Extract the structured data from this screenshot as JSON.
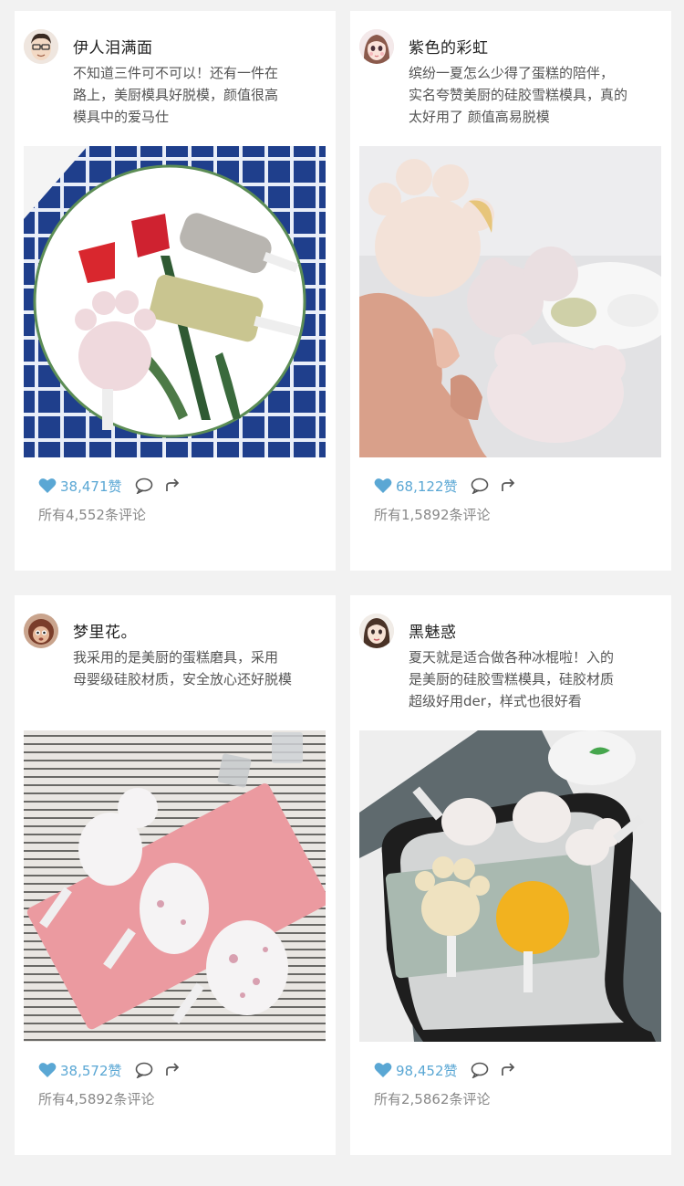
{
  "colors": {
    "background": "#f2f2f2",
    "card": "#ffffff",
    "like_accent": "#5aa7d4",
    "muted_text": "#888888"
  },
  "posts": [
    {
      "username": "伊人泪满面",
      "text_lines": [
        "不知道三件可不可以！还有一件在",
        "路上，美厨模具好脱模，颜值很高",
        "模具中的爱马仕"
      ],
      "likes": "38,471赞",
      "comments": "所有4,552条评论",
      "image": "popsicles-on-plate-blue-checkered-cloth"
    },
    {
      "username": "紫色的彩虹",
      "text_lines": [
        "缤纷一夏怎么少得了蛋糕的陪伴，",
        "实名夸赞美厨的硅胶雪糕模具，真的",
        "太好用了 颜值高易脱模"
      ],
      "likes": "68,122赞",
      "comments": "所有1,5892条评论",
      "image": "hand-holding-paw-and-snowman-popsicles"
    },
    {
      "username": "梦里花。",
      "text_lines": [
        "我采用的是美厨的蛋糕磨具，采用",
        "母婴级硅胶材质，安全放心还好脱模"
      ],
      "likes": "38,572赞",
      "comments": "所有4,5892条评论",
      "image": "pink-silicone-mold-on-striped-mat"
    },
    {
      "username": "黑魅惑",
      "text_lines": [
        "夏天就是适合做各种冰棍啦！入的",
        "是美厨的硅胶雪糕模具，硅胶材质",
        "超级好用der，样式也很好看"
      ],
      "likes": "98,452赞",
      "comments": "所有2,5862条评论",
      "image": "green-mold-with-mango-popsicle-on-board"
    }
  ]
}
